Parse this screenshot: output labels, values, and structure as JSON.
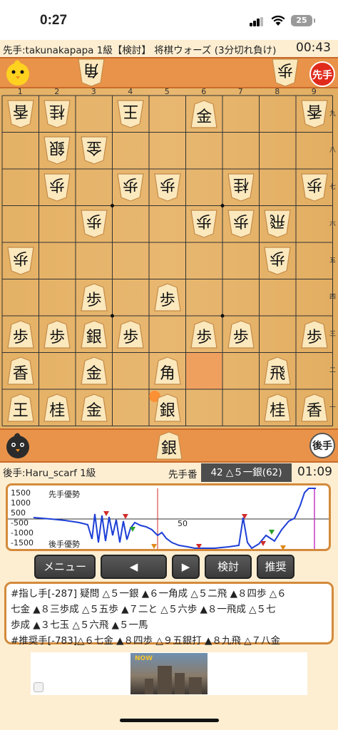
{
  "status_bar": {
    "time": "0:27",
    "battery": "25"
  },
  "header": {
    "title": "先手:takunakapapa 1級【検討】 将棋ウォーズ (3分切れ負け)",
    "clock": "00:43"
  },
  "top_player": {
    "hand": [
      {
        "char": "角",
        "count": 1
      },
      {
        "char": "歩",
        "count": 1
      }
    ],
    "badge": "先手"
  },
  "bottom_player": {
    "hand": [
      {
        "char": "銀",
        "count": 1
      }
    ],
    "badge": "後手"
  },
  "board": {
    "file_labels": [
      "1",
      "2",
      "3",
      "4",
      "5",
      "6",
      "7",
      "8",
      "9"
    ],
    "rank_labels": [
      "九",
      "八",
      "七",
      "六",
      "五",
      "四",
      "三",
      "二",
      "一"
    ],
    "pieces": [
      {
        "file": 1,
        "rank": 1,
        "char": "香",
        "dir": "down"
      },
      {
        "file": 2,
        "rank": 1,
        "char": "桂",
        "dir": "down"
      },
      {
        "file": 4,
        "rank": 1,
        "char": "王",
        "dir": "down"
      },
      {
        "file": 6,
        "rank": 1,
        "char": "金",
        "dir": "up"
      },
      {
        "file": 9,
        "rank": 1,
        "char": "香",
        "dir": "down"
      },
      {
        "file": 2,
        "rank": 2,
        "char": "銀",
        "dir": "down"
      },
      {
        "file": 3,
        "rank": 2,
        "char": "金",
        "dir": "down"
      },
      {
        "file": 2,
        "rank": 3,
        "char": "歩",
        "dir": "down"
      },
      {
        "file": 4,
        "rank": 3,
        "char": "歩",
        "dir": "down"
      },
      {
        "file": 5,
        "rank": 3,
        "char": "歩",
        "dir": "down"
      },
      {
        "file": 7,
        "rank": 3,
        "char": "桂",
        "dir": "down"
      },
      {
        "file": 9,
        "rank": 3,
        "char": "歩",
        "dir": "down"
      },
      {
        "file": 3,
        "rank": 4,
        "char": "歩",
        "dir": "down"
      },
      {
        "file": 6,
        "rank": 4,
        "char": "歩",
        "dir": "down"
      },
      {
        "file": 7,
        "rank": 4,
        "char": "歩",
        "dir": "down"
      },
      {
        "file": 8,
        "rank": 4,
        "char": "飛",
        "dir": "down"
      },
      {
        "file": 1,
        "rank": 5,
        "char": "歩",
        "dir": "down"
      },
      {
        "file": 8,
        "rank": 5,
        "char": "歩",
        "dir": "down"
      },
      {
        "file": 3,
        "rank": 6,
        "char": "歩",
        "dir": "up"
      },
      {
        "file": 5,
        "rank": 6,
        "char": "歩",
        "dir": "up"
      },
      {
        "file": 1,
        "rank": 7,
        "char": "歩",
        "dir": "up"
      },
      {
        "file": 2,
        "rank": 7,
        "char": "歩",
        "dir": "up"
      },
      {
        "file": 3,
        "rank": 7,
        "char": "銀",
        "dir": "up"
      },
      {
        "file": 4,
        "rank": 7,
        "char": "歩",
        "dir": "up"
      },
      {
        "file": 6,
        "rank": 7,
        "char": "歩",
        "dir": "up"
      },
      {
        "file": 7,
        "rank": 7,
        "char": "歩",
        "dir": "up"
      },
      {
        "file": 9,
        "rank": 7,
        "char": "歩",
        "dir": "up"
      },
      {
        "file": 1,
        "rank": 8,
        "char": "香",
        "dir": "up"
      },
      {
        "file": 3,
        "rank": 8,
        "char": "金",
        "dir": "up"
      },
      {
        "file": 5,
        "rank": 8,
        "char": "角",
        "dir": "up"
      },
      {
        "file": 8,
        "rank": 8,
        "char": "飛",
        "dir": "up"
      },
      {
        "file": 1,
        "rank": 9,
        "char": "王",
        "dir": "up"
      },
      {
        "file": 2,
        "rank": 9,
        "char": "桂",
        "dir": "up"
      },
      {
        "file": 3,
        "rank": 9,
        "char": "金",
        "dir": "up"
      },
      {
        "file": 5,
        "rank": 9,
        "char": "銀",
        "dir": "up"
      },
      {
        "file": 8,
        "rank": 9,
        "char": "桂",
        "dir": "up"
      },
      {
        "file": 9,
        "rank": 9,
        "char": "香",
        "dir": "up"
      }
    ],
    "highlight_square": {
      "file": 6,
      "rank": 8
    },
    "last_move_square": {
      "file": 5,
      "rank": 9
    }
  },
  "bottom_info": {
    "player": "後手:Haru_scarf 1級",
    "turn_label": "先手番",
    "move": "42 △５一銀(62)",
    "clock": "01:09"
  },
  "graph": {
    "y_labels": [
      "1500",
      "1000",
      "500",
      "-500",
      "-1000",
      "-1500"
    ],
    "sente_label": "先手優勢",
    "gote_label": "後手優勢",
    "mid_label": "50",
    "colors": {
      "line": "#1d3fd6",
      "current_marker": "#d22b2b",
      "end_marker": "#c33ac9"
    }
  },
  "buttons": {
    "menu": "メニュー",
    "prev": "◀",
    "next": "▶",
    "analyze": "検討",
    "recommend": "推奨"
  },
  "comment": {
    "line1": "#指し手[-287] 疑問 △５一銀 ▲６一角成 △５二飛 ▲８四歩 △６",
    "line2": "七金 ▲８三歩成 △５五歩 ▲７二と △５六歩 ▲８一飛成 △５七",
    "line3": "歩成 ▲３七玉 △５六飛 ▲５一馬",
    "line4": "#推奨手[-783]△６七金 ▲８四歩 △９五銀打 ▲８九飛 △７八金"
  },
  "ad": {
    "logo": "NOW"
  }
}
